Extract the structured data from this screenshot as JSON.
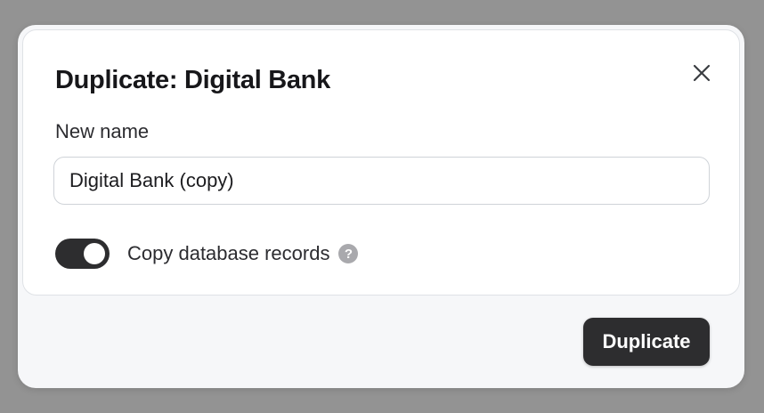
{
  "dialog": {
    "title": "Duplicate: Digital Bank",
    "close_icon": "close-icon"
  },
  "form": {
    "name_label": "New name",
    "name_value": "Digital Bank (copy)",
    "copy_records_label": "Copy database records",
    "copy_records_enabled": true,
    "help_icon": "question-circle-icon",
    "help_glyph": "?"
  },
  "footer": {
    "duplicate_label": "Duplicate"
  },
  "colors": {
    "overlay": "#939393",
    "dialog_bg": "#f6f7f9",
    "card_bg": "#ffffff",
    "toggle_on": "#2d2d2f",
    "primary_button": "#2d2d2f",
    "help_icon": "#a9a9ad"
  }
}
